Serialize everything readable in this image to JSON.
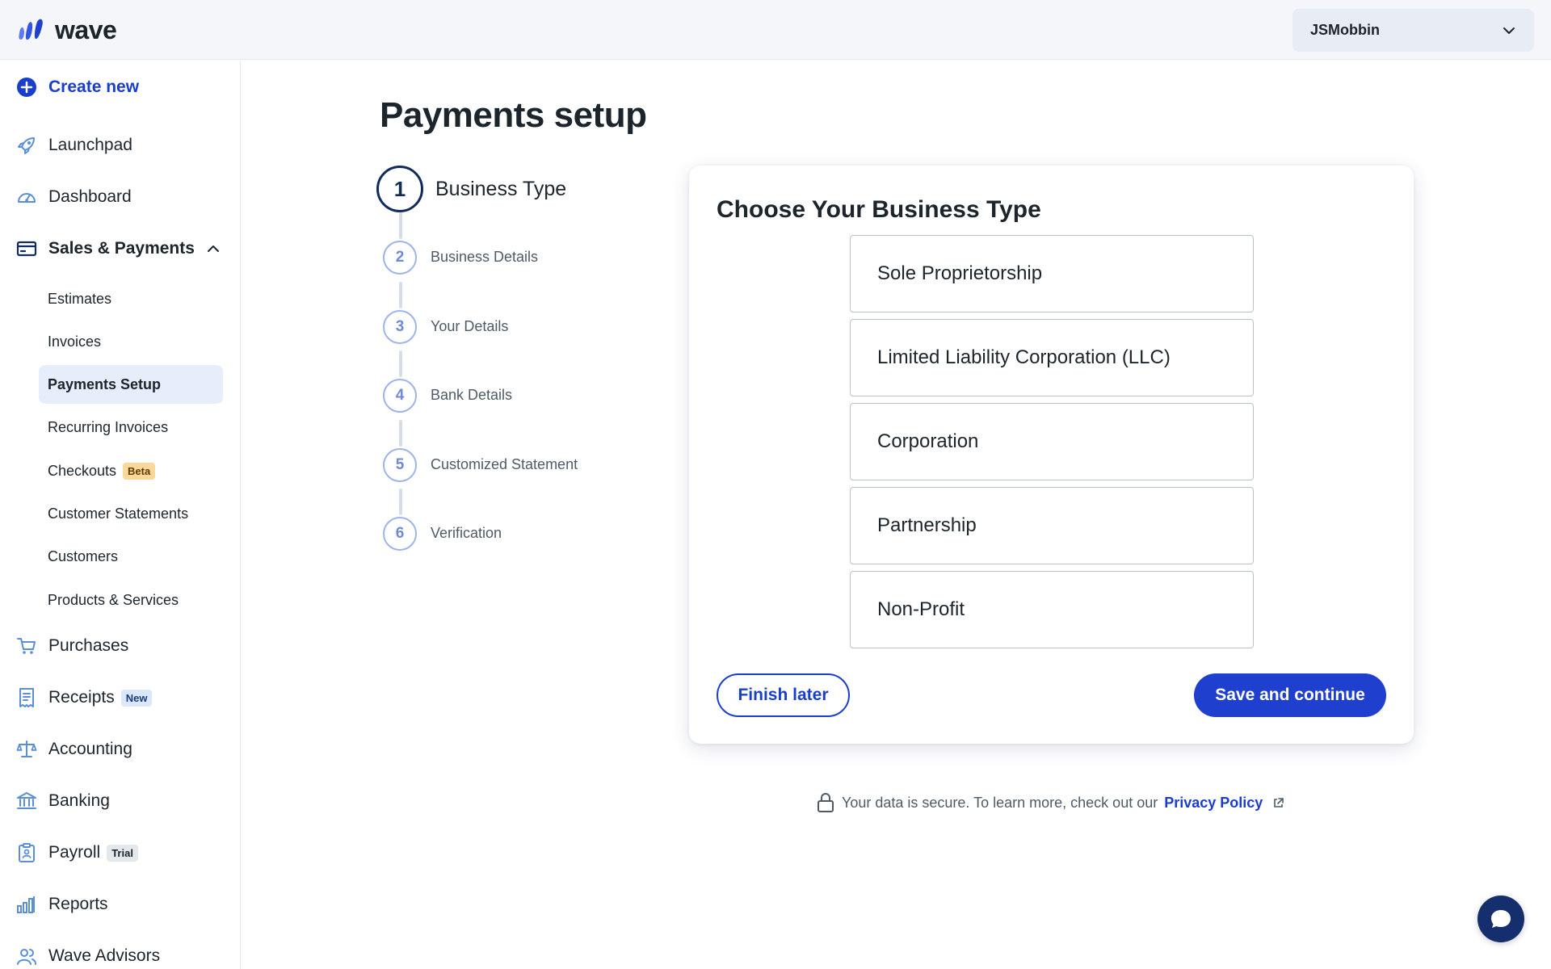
{
  "header": {
    "brand": "wave",
    "account_name": "JSMobbin"
  },
  "sidebar": {
    "create_new": "Create new",
    "items": {
      "launchpad": "Launchpad",
      "dashboard": "Dashboard",
      "sales_payments": "Sales & Payments",
      "purchases": "Purchases",
      "receipts": "Receipts",
      "accounting": "Accounting",
      "banking": "Banking",
      "payroll": "Payroll",
      "reports": "Reports",
      "wave_advisors": "Wave Advisors"
    },
    "sales_sub": {
      "estimates": "Estimates",
      "invoices": "Invoices",
      "payments_setup": "Payments Setup",
      "recurring_invoices": "Recurring Invoices",
      "checkouts": "Checkouts",
      "customer_statements": "Customer Statements",
      "customers": "Customers",
      "products_services": "Products & Services"
    },
    "badges": {
      "checkouts": "Beta",
      "receipts": "New",
      "payroll": "Trial"
    }
  },
  "main": {
    "title": "Payments setup",
    "steps": [
      {
        "number": "1",
        "label": "Business Type"
      },
      {
        "number": "2",
        "label": "Business Details"
      },
      {
        "number": "3",
        "label": "Your Details"
      },
      {
        "number": "4",
        "label": "Bank Details"
      },
      {
        "number": "5",
        "label": "Customized Statement"
      },
      {
        "number": "6",
        "label": "Verification"
      }
    ],
    "card": {
      "title": "Choose Your Business Type",
      "options": [
        "Sole Proprietorship",
        "Limited Liability Corporation (LLC)",
        "Corporation",
        "Partnership",
        "Non-Profit"
      ],
      "finish_later": "Finish later",
      "save_continue": "Save and continue"
    },
    "secure_note": "Your data is secure. To learn more, check out our",
    "privacy_link": "Privacy Policy"
  },
  "colors": {
    "accent": "#1a3ecc",
    "navy": "#112b5c",
    "active_bg": "#e6eefc"
  }
}
